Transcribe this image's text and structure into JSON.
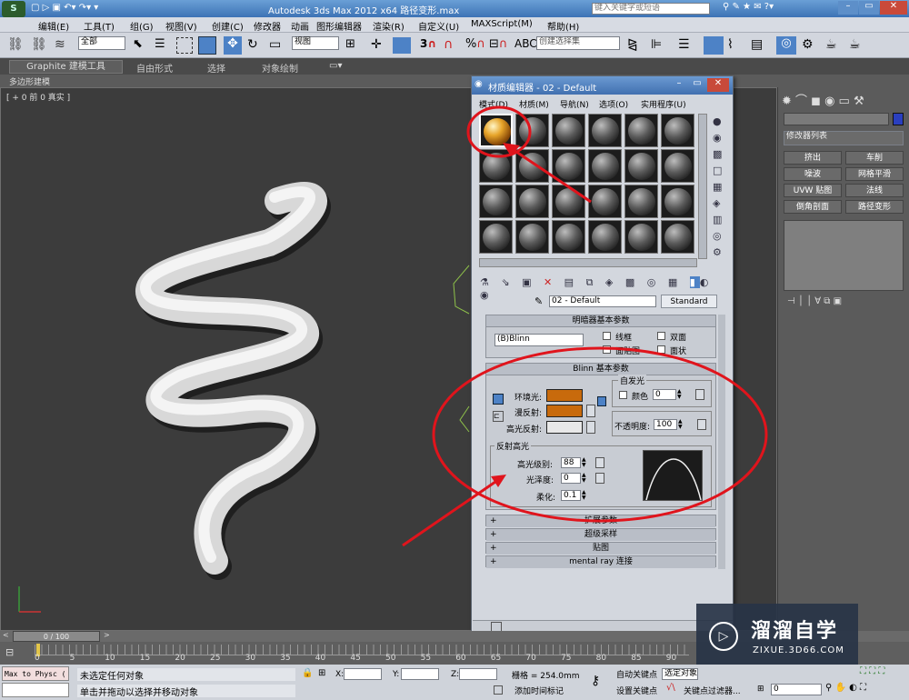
{
  "window_title": "Autodesk 3ds Max  2012 x64       路径变形.max",
  "search_placeholder": "键入关键字或短语",
  "menu": [
    "编辑(E)",
    "工具(T)",
    "组(G)",
    "视图(V)",
    "创建(C)",
    "修改器",
    "动画",
    "图形编辑器",
    "渲染(R)",
    "自定义(U)",
    "MAXScript(M)",
    "帮助(H)"
  ],
  "toolbar": {
    "selection_filter": "全部",
    "ref_coord": "视图",
    "selection_set": "创建选择集",
    "angle_snap": "3",
    "percent_snap": "%"
  },
  "ribbon": {
    "tabs": [
      "Graphite 建模工具",
      "自由形式",
      "选择",
      "对象绘制"
    ],
    "sub": "多边形建模"
  },
  "viewport": {
    "label": "[ + 0 前 0 真实 ]"
  },
  "mat_editor": {
    "title": "材质编辑器 - 02 - Default",
    "menu": [
      "模式(D)",
      "材质(M)",
      "导航(N)",
      "选项(O)",
      "实用程序(U)"
    ],
    "material_name": "02 - Default",
    "material_type": "Standard",
    "shader_rollout": "明暗器基本参数",
    "shader": "(B)Blinn",
    "wire": "线框",
    "two_sided": "双面",
    "face_map": "面贴图",
    "faceted": "面状",
    "blinn_rollout": "Blinn 基本参数",
    "self_illum": "自发光",
    "color": "颜色",
    "self_illum_val": "0",
    "ambient": "环境光:",
    "diffuse": "漫反射:",
    "specular": "高光反射:",
    "opacity": "不透明度:",
    "opacity_val": "100",
    "spec_group": "反射高光",
    "spec_level": "高光级别:",
    "spec_level_val": "88",
    "gloss": "光泽度:",
    "gloss_val": "0",
    "soften": "柔化:",
    "soften_val": "0.1",
    "collapsed": [
      "扩展参数",
      "超级采样",
      "贴图",
      "mental ray 连接"
    ]
  },
  "cmd": {
    "modifier_list": "修改器列表",
    "buttons": [
      "挤出",
      "车削",
      "噪波",
      "网格平滑",
      "UVW 贴图",
      "法线",
      "倒角剖面",
      "路径变形"
    ]
  },
  "timeline": {
    "frame": "0 / 100",
    "ticks": [
      "0",
      "5",
      "10",
      "15",
      "20",
      "25",
      "30",
      "35",
      "40",
      "45",
      "50",
      "55",
      "60",
      "65",
      "70",
      "75",
      "80",
      "85",
      "90"
    ]
  },
  "status": {
    "script": "Max to Physc (",
    "line1": "未选定任何对象",
    "line2": "单击并拖动以选择并移动对象",
    "x": "X:",
    "y": "Y:",
    "z": "Z:",
    "grid": "栅格 = 254.0mm",
    "auto_key": "自动关键点",
    "set_key": "设置关键点",
    "selected": "选定对象",
    "key_filter": "关键点过滤器...",
    "add_tag": "添加时间标记",
    "frame_val": "0"
  },
  "watermark": {
    "name": "溜溜自学",
    "url": "ZIXUE.3D66.COM"
  },
  "colors": {
    "ambient": "#c86a0c",
    "diffuse": "#c86a0c",
    "specular": "#e8e8e8",
    "annotation": "#e0141c"
  }
}
